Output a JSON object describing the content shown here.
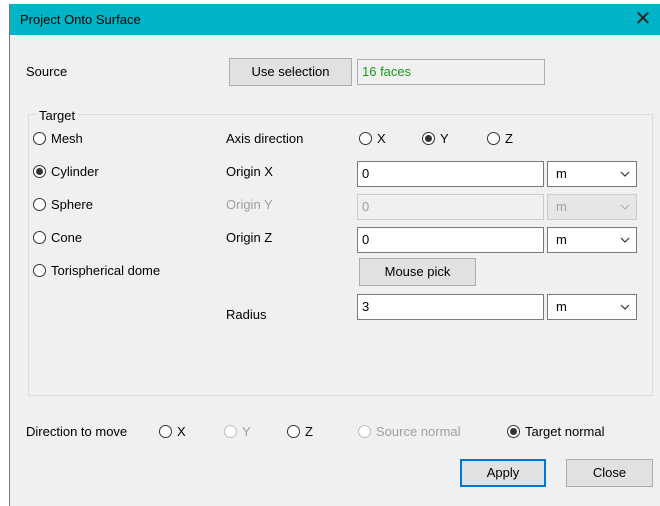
{
  "window": {
    "title": "Project Onto Surface",
    "close_glyph": "✕"
  },
  "source": {
    "label": "Source",
    "button": "Use selection",
    "value": "16 faces",
    "value_color": "#1a9a1a"
  },
  "target": {
    "label": "Target",
    "shapes": [
      {
        "label": "Mesh",
        "selected": false
      },
      {
        "label": "Cylinder",
        "selected": true
      },
      {
        "label": "Sphere",
        "selected": false
      },
      {
        "label": "Cone",
        "selected": false
      },
      {
        "label": "Torispherical dome",
        "selected": false
      }
    ],
    "axis_direction": {
      "label": "Axis direction",
      "options": [
        {
          "label": "X",
          "selected": false
        },
        {
          "label": "Y",
          "selected": true
        },
        {
          "label": "Z",
          "selected": false
        }
      ]
    },
    "origin_x": {
      "label": "Origin X",
      "value": "0",
      "unit": "m"
    },
    "origin_y": {
      "label": "Origin Y",
      "value": "0",
      "unit": "m",
      "disabled": true
    },
    "origin_z": {
      "label": "Origin Z",
      "value": "0",
      "unit": "m"
    },
    "mouse_pick": "Mouse pick",
    "radius": {
      "label": "Radius",
      "value": "3",
      "unit": "m"
    }
  },
  "direction": {
    "label": "Direction to move",
    "options": [
      {
        "label": "X",
        "selected": false,
        "disabled": false
      },
      {
        "label": "Y",
        "selected": false,
        "disabled": true
      },
      {
        "label": "Z",
        "selected": false,
        "disabled": false
      },
      {
        "label": "Source normal",
        "selected": false,
        "disabled": true
      },
      {
        "label": "Target normal",
        "selected": true,
        "disabled": false
      }
    ]
  },
  "buttons": {
    "apply": "Apply",
    "close": "Close"
  },
  "colors": {
    "titlebar": "#00b4c8",
    "default_button_border": "#0078d7"
  }
}
